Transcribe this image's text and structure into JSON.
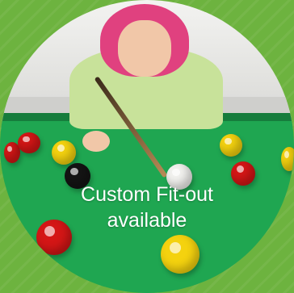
{
  "caption": {
    "line1": "Custom Fit-out",
    "line2": "available"
  },
  "colors": {
    "background": "#6db33f",
    "felt": "#1fa651",
    "caption_text": "#ffffff"
  }
}
